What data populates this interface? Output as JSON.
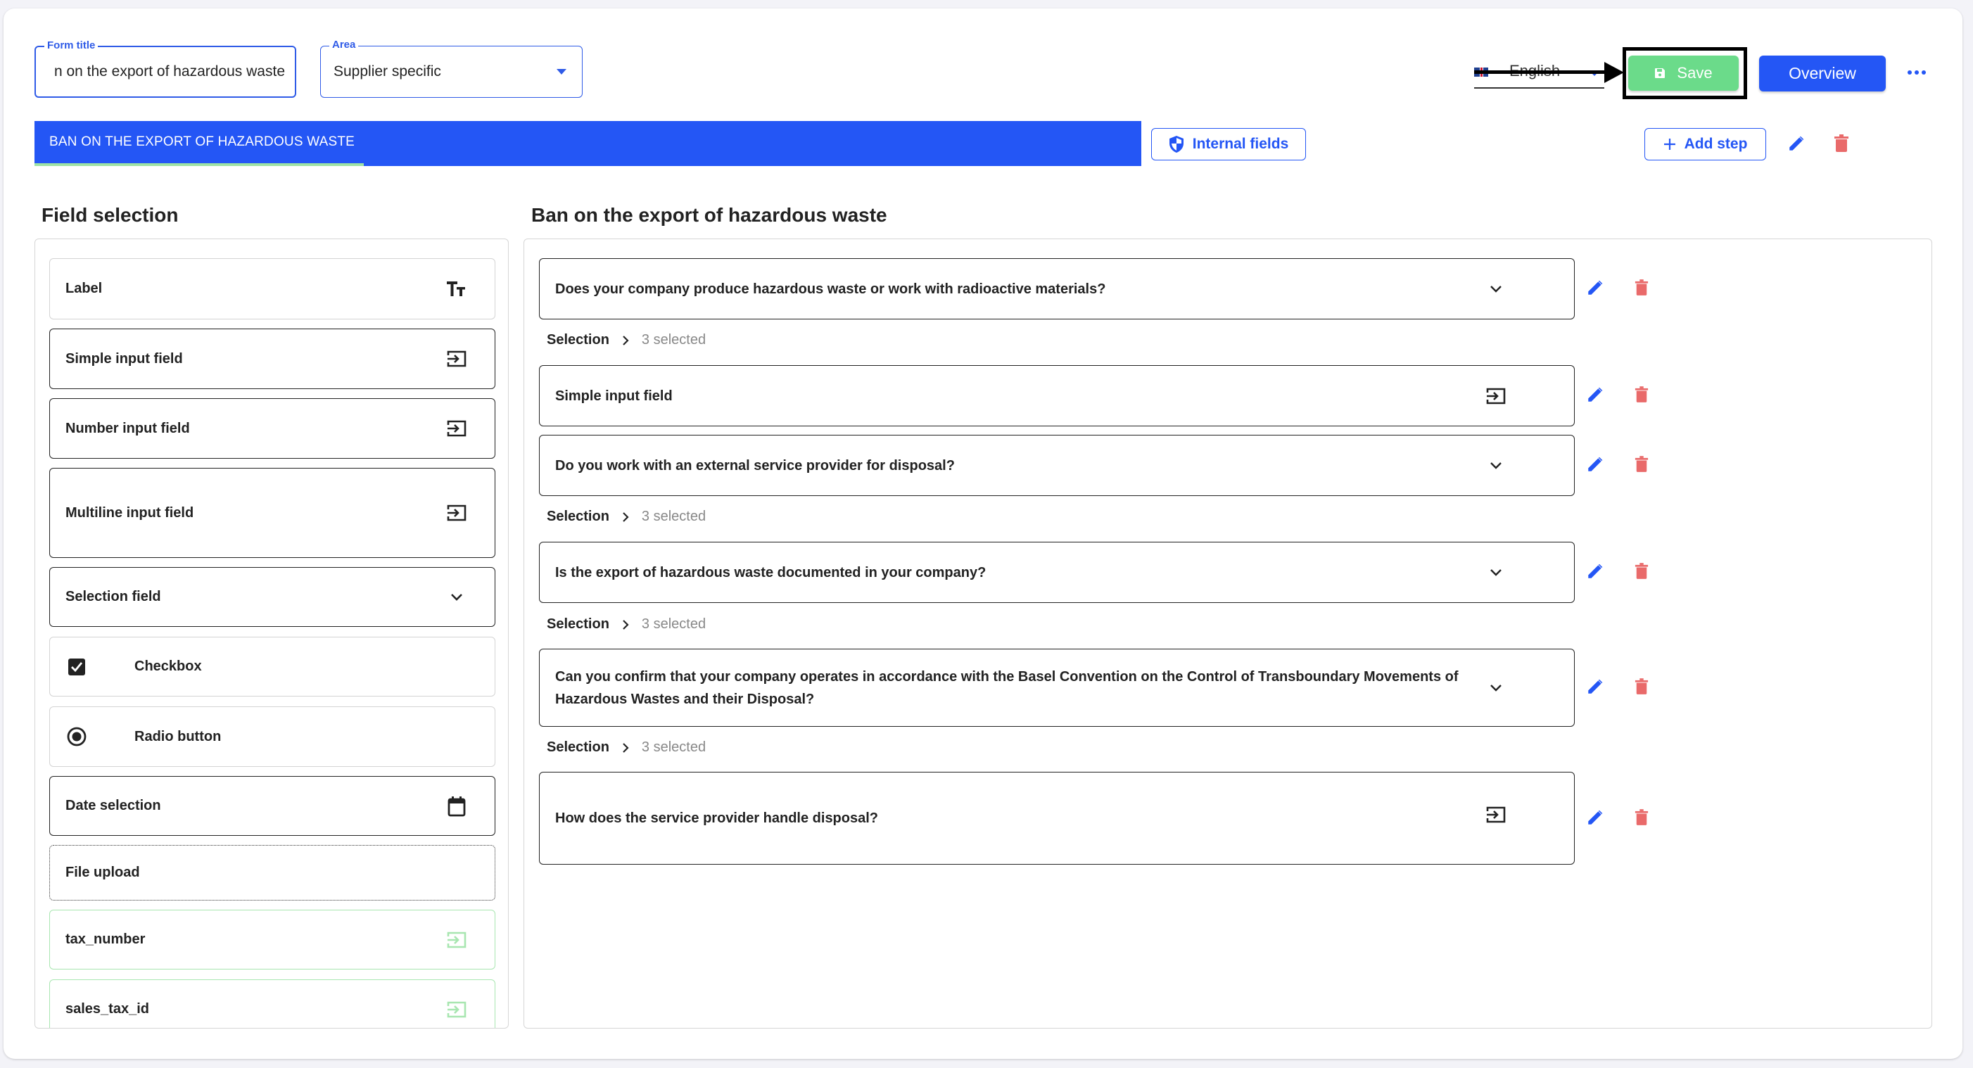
{
  "header": {
    "form_title": {
      "label": "Form title",
      "value": "n on the export of hazardous waste"
    },
    "area": {
      "label": "Area",
      "value": "Supplier specific"
    },
    "language": {
      "value": "English",
      "flag": "uk-flag"
    },
    "save_label": "Save",
    "overview_label": "Overview",
    "more_icon": "more-horizontal-icon"
  },
  "steps": {
    "tabs": [
      {
        "label": "BAN ON THE EXPORT OF HAZARDOUS WASTE",
        "active": true
      }
    ],
    "internal_fields_label": "Internal fields",
    "add_step_label": "Add step"
  },
  "field_selection": {
    "title": "Field selection",
    "items": [
      {
        "label": "Label",
        "icon": "text-size-icon",
        "style": "light"
      },
      {
        "label": "Simple input field",
        "icon": "input-icon",
        "style": "solid"
      },
      {
        "label": "Number input field",
        "icon": "input-icon",
        "style": "solid"
      },
      {
        "label": "Multiline input field",
        "icon": "input-icon",
        "style": "solid"
      },
      {
        "label": "Selection field",
        "icon": "chevron-down-icon",
        "style": "solid"
      },
      {
        "label": "Checkbox",
        "icon": "checkbox-checked-icon",
        "style": "light"
      },
      {
        "label": "Radio button",
        "icon": "radio-checked-icon",
        "style": "light"
      },
      {
        "label": "Date selection",
        "icon": "calendar-icon",
        "style": "solid"
      },
      {
        "label": "File upload",
        "icon": "",
        "style": "dotted"
      },
      {
        "label": "tax_number",
        "icon": "input-icon",
        "style": "green"
      },
      {
        "label": "sales_tax_id",
        "icon": "input-icon",
        "style": "green"
      }
    ]
  },
  "step_content": {
    "title": "Ban on the export of hazardous waste",
    "questions": [
      {
        "text": "Does your company produce hazardous waste or work with radioactive materials?",
        "icon": "chevron-down-icon",
        "selection": {
          "label": "Selection",
          "count": "3 selected"
        }
      },
      {
        "text": "Simple input field",
        "icon": "input-icon",
        "selection": null
      },
      {
        "text": "Do you work with an external service provider for disposal?",
        "icon": "chevron-down-icon",
        "selection": {
          "label": "Selection",
          "count": "3 selected"
        }
      },
      {
        "text": "Is the export of hazardous waste documented in your company?",
        "icon": "chevron-down-icon",
        "selection": {
          "label": "Selection",
          "count": "3 selected"
        }
      },
      {
        "text": "Can you confirm that your company operates in accordance with the Basel Convention on the Control of Transboundary Movements of Hazardous Wastes and their Disposal?",
        "icon": "chevron-down-icon",
        "selection": {
          "label": "Selection",
          "count": "3 selected"
        }
      },
      {
        "text": "How does the service provider handle disposal?",
        "icon": "input-icon",
        "selection": null
      }
    ]
  },
  "colors": {
    "primary": "#2456f5",
    "save_green": "#6bdb8a",
    "delete_red": "#e96a6a",
    "tab_underline": "#9ee3a5",
    "custom_field_green": "#a8e6b0"
  }
}
